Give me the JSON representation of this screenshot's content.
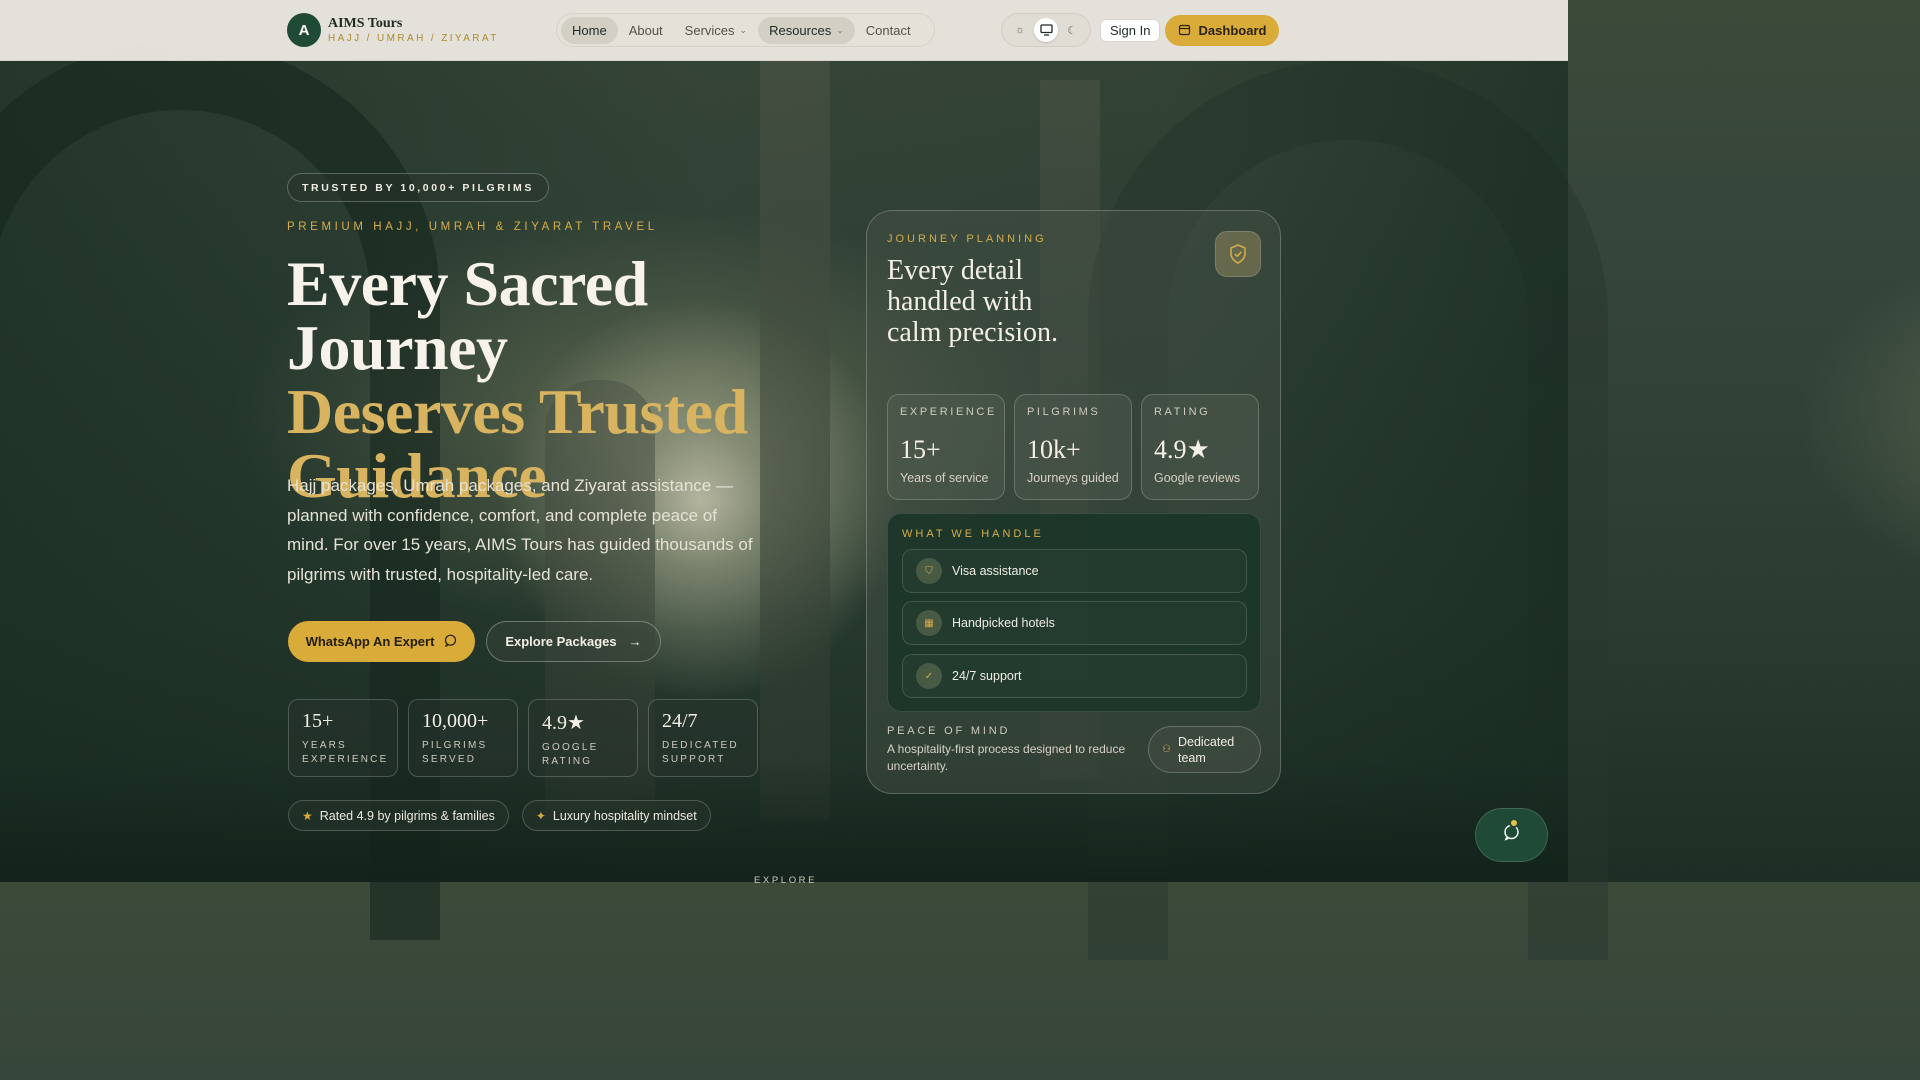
{
  "colors": {
    "accent": "#d9ab39",
    "brand": "#1f4a35",
    "gold_text": "#d8b460"
  },
  "header": {
    "logo_letter": "A",
    "brand_name": "AIMS Tours",
    "brand_tagline": "HAJJ / UMRAH / ZIYARAT",
    "nav": [
      {
        "label": "Home",
        "active": true
      },
      {
        "label": "About"
      },
      {
        "label": "Services",
        "dropdown": true
      },
      {
        "label": "Resources",
        "dropdown": true
      },
      {
        "label": "Contact"
      }
    ],
    "theme_toggle": {
      "options": [
        "sun-icon",
        "monitor-icon",
        "moon-icon"
      ],
      "selected": "monitor-icon"
    },
    "signin_label": "Sign In",
    "dashboard_label": "Dashboard"
  },
  "hero": {
    "trust_badge": "TRUSTED BY 10,000+ PILGRIMS",
    "kicker": "PREMIUM HAJJ, UMRAH & ZIYARAT TRAVEL",
    "title_line1": "Every Sacred Journey",
    "title_line2": "Deserves Trusted Guidance",
    "lead": "Hajj packages, Umrah packages, and Ziyarat assistance — planned with confidence, comfort, and complete peace of mind. For over 15 years, AIMS Tours has guided thousands of pilgrims with trusted, hospitality-led care.",
    "cta_whatsapp": "WhatsApp An Expert",
    "cta_explore": "Explore Packages",
    "stats": [
      {
        "value": "15+",
        "label": "YEARS EXPERIENCE"
      },
      {
        "value": "10,000+",
        "label": "PILGRIMS SERVED"
      },
      {
        "value": "4.9★",
        "label": "GOOGLE RATING"
      },
      {
        "value": "24/7",
        "label": "DEDICATED SUPPORT"
      }
    ],
    "chips": [
      {
        "icon": "star-icon",
        "label": "Rated 4.9 by pilgrims & families"
      },
      {
        "icon": "sparkle-icon",
        "label": "Luxury hospitality mindset"
      }
    ],
    "explore_label": "EXPLORE"
  },
  "card": {
    "kicker": "JOURNEY PLANNING",
    "title": "Every detail handled with calm precision.",
    "stats": [
      {
        "key": "EXPERIENCE",
        "value": "15+",
        "sub": "Years of service"
      },
      {
        "key": "PILGRIMS",
        "value": "10k+",
        "sub": "Journeys guided"
      },
      {
        "key": "RATING",
        "value": "4.9★",
        "sub": "Google reviews"
      }
    ],
    "handle_title": "WHAT WE HANDLE",
    "handle_items": [
      {
        "icon": "shield-icon",
        "label": "Visa assistance"
      },
      {
        "icon": "building-icon",
        "label": "Handpicked hotels"
      },
      {
        "icon": "check-circle-icon",
        "label": "24/7 support"
      }
    ],
    "peace_title": "PEACE OF MIND",
    "peace_text": "A hospitality-first process designed to reduce uncertainty.",
    "team_label": "Dedicated team"
  }
}
